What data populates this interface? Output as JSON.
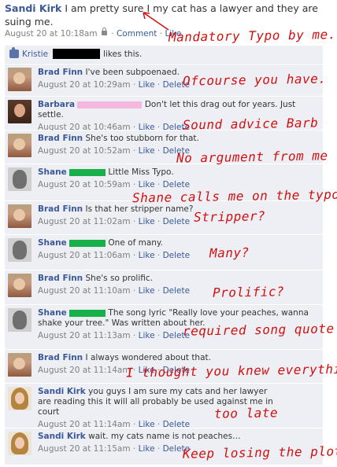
{
  "post": {
    "author": "Sandi Kirk",
    "text": "I am pretty sure I my cat has a lawyer and they are suing me.",
    "timestamp": "August 20 at 10:18am",
    "comment_link": "Comment",
    "like_link": "Like",
    "separator": "·"
  },
  "likes": {
    "liker": "Kristie",
    "text": "likes this."
  },
  "comments": [
    {
      "author": "Brad Finn",
      "text": "I've been subpoenaed.",
      "time": "August 20 at 10:29am"
    },
    {
      "author": "Barbara",
      "text": "Don't let this drag out for years. Just settle.",
      "time": "August 20 at 10:46am"
    },
    {
      "author": "Brad Finn",
      "text": "She's too stubborn for that.",
      "time": "August 20 at 10:52am"
    },
    {
      "author": "Shane",
      "text": "Little Miss Typo.",
      "time": "August 20 at 10:59am"
    },
    {
      "author": "Brad Finn",
      "text": "Is that her stripper name?",
      "time": "August 20 at 11:02am"
    },
    {
      "author": "Shane",
      "text": "One of many.",
      "time": "August 20 at 11:06am"
    },
    {
      "author": "Brad Finn",
      "text": "She's so prolific.",
      "time": "August 20 at 11:10am"
    },
    {
      "author": "Shane",
      "text": "The song lyric \"Really love your peaches, wanna shake your tree.\" Was written about her.",
      "time": "August 20 at 11:13am"
    },
    {
      "author": "Brad Finn",
      "text": "I always wondered about that.",
      "time": "August 20 at 11:14am"
    },
    {
      "author": "Sandi Kirk",
      "text": "you guys I am sure my cats and her lawyer are reading this it will all probably be used against me in court",
      "time": "August 20 at 11:14am"
    },
    {
      "author": "Sandi Kirk",
      "text": "wait. my cats name is not peaches…",
      "time": "August 20 at 11:15am"
    }
  ],
  "links": {
    "like": "Like",
    "delete": "Delete",
    "separator": "·"
  },
  "annotations": [
    "Mandatory Typo by me.",
    "Ofcourse you have.",
    "Sound advice Barb",
    "No argument from me",
    "Shane calls me on the typo",
    "Stripper?",
    "Many?",
    "Prolific?",
    "required song quote",
    "I thought you knew everything",
    "too late",
    "Keep losing the plot"
  ],
  "colors": {
    "link": "#3b5998",
    "comment_bg": "#edeff4",
    "annotation": "#d11010",
    "redaction_green": "#17b04a",
    "redaction_pink": "#f3b7e0"
  }
}
